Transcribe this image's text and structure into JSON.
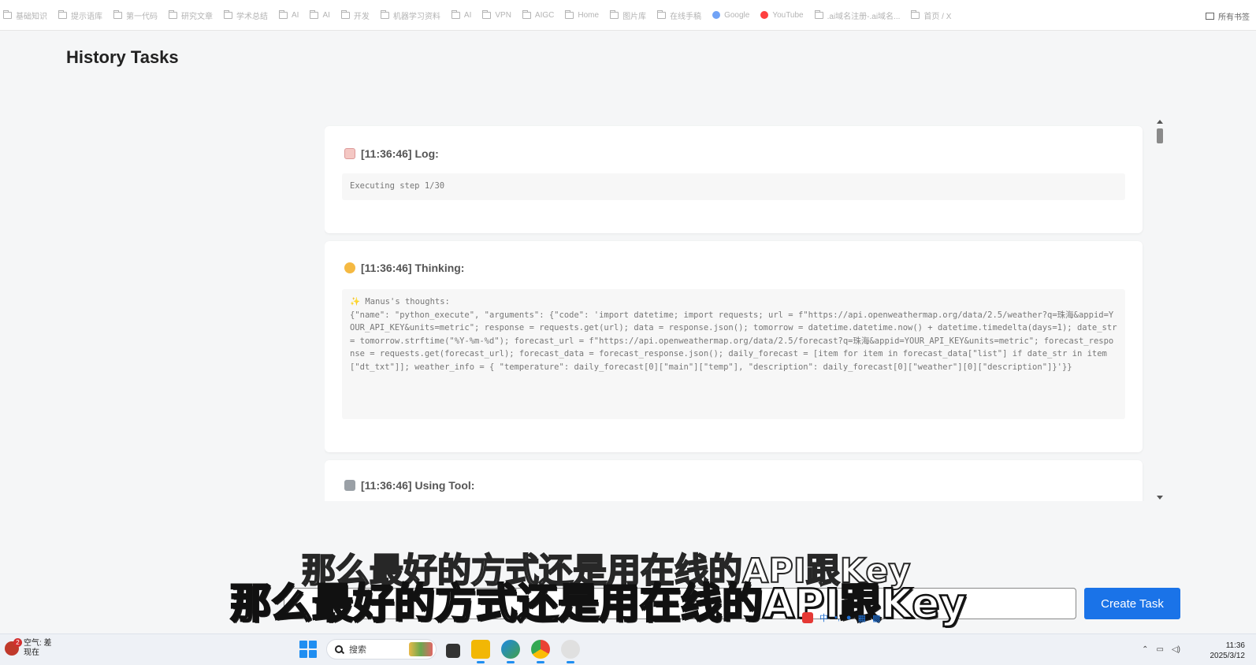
{
  "bookmarks_bar": {
    "items": [
      "基础知识",
      "提示语库",
      "第一代码",
      "研究文章",
      "学术总结",
      "AI",
      "AI",
      "开发",
      "机器学习资料",
      "AI",
      "VPN",
      "AIGC",
      "Home",
      "图片库",
      "在线手稿",
      "Google",
      "YouTube",
      ".ai域名注册-.ai域名...",
      "首页 / X"
    ],
    "all_bookmarks": "所有书签"
  },
  "page": {
    "title": "History Tasks"
  },
  "cards": [
    {
      "timestamp": "[11:36:46] Log:",
      "icon": "memo-emoji-icon",
      "content": "Executing step 1/30"
    },
    {
      "timestamp": "[11:36:46] Thinking:",
      "icon": "thinking-face-emoji-icon",
      "content": "✨ Manus's thoughts:\n{\"name\": \"python_execute\", \"arguments\": {\"code\": 'import datetime; import requests; url = f\"https://api.openweathermap.org/data/2.5/weather?q=珠海&appid=YOUR_API_KEY&units=metric\"; response = requests.get(url); data = response.json(); tomorrow = datetime.datetime.now() + datetime.timedelta(days=1); date_str = tomorrow.strftime(\"%Y-%m-%d\"); forecast_url = f\"https://api.openweathermap.org/data/2.5/forecast?q=珠海&appid=YOUR_API_KEY&units=metric\"; forecast_response = requests.get(forecast_url); forecast_data = forecast_response.json(); daily_forecast = [item for item in forecast_data[\"list\"] if date_str in item[\"dt_txt\"]]; weather_info = { \"temperature\": daily_forecast[0][\"main\"][\"temp\"], \"description\": daily_forecast[0][\"weather\"][0][\"description\"]}'}}"
    },
    {
      "timestamp": "[11:36:46] Using Tool:",
      "icon": "tools-emoji-icon",
      "content": ""
    }
  ],
  "task_input": {
    "value": "",
    "placeholder": ""
  },
  "create_button": {
    "label": "Create Task"
  },
  "subtitles": {
    "line1": "那么最好的方式还是用在线的API跟Key",
    "line2": "那么最好的方式还是用在线的API跟Key"
  },
  "taskbar": {
    "weather_label": "空气: 差",
    "weather_sub": "现在",
    "weather_badge": "2",
    "search_label": "搜索",
    "ime_label": "中",
    "time": "11:36",
    "date": "2025/3/12"
  },
  "colors": {
    "accent": "#1a73e8",
    "card_bg": "#ffffff",
    "page_bg": "#f5f6f7",
    "code_bg": "#f7f7f7"
  }
}
